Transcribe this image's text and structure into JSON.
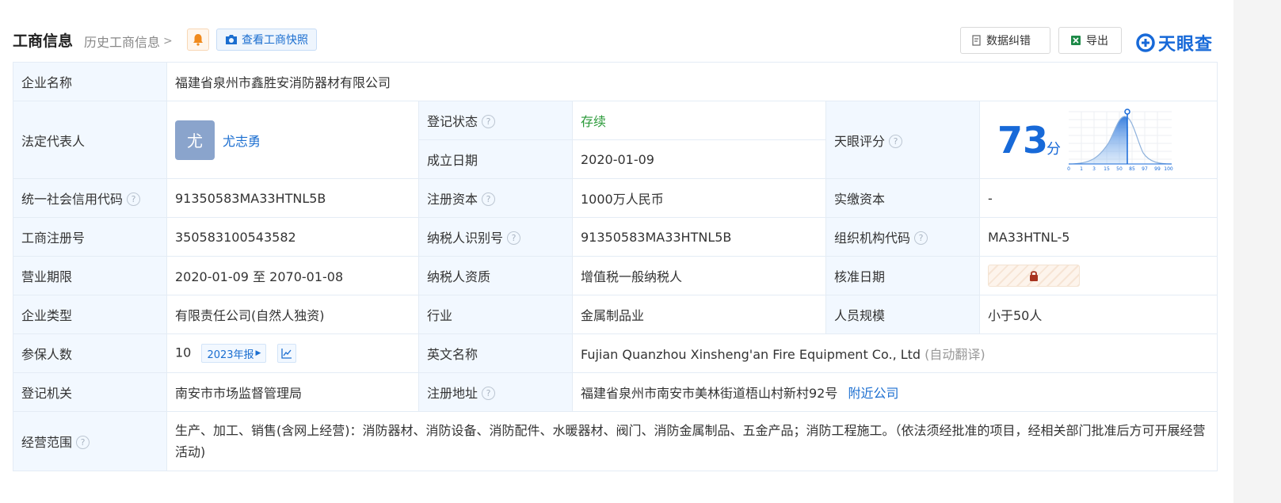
{
  "header": {
    "title": "工商信息",
    "history_link": "历史工商信息",
    "snapshot_label": "查看工商快照",
    "correct_label": "数据纠错",
    "export_label": "导出",
    "logo_text": "天眼查"
  },
  "colors": {
    "accent": "#1769d8",
    "label_bg": "#f2f8ff",
    "status_green": "#2b9a3a"
  },
  "company": {
    "name_label": "企业名称",
    "name": "福建省泉州市鑫胜安消防器材有限公司",
    "legal_label": "法定代表人",
    "legal_avatar": "尤",
    "legal_name": "尤志勇",
    "status_label": "登记状态",
    "status": "存续",
    "founded_label": "成立日期",
    "founded": "2020-01-09",
    "score_label": "天眼评分",
    "score": "73",
    "score_unit": "分",
    "score_ticks": [
      "0",
      "1",
      "3",
      "15",
      "50",
      "85",
      "97",
      "99",
      "100"
    ],
    "credit_label": "统一社会信用代码",
    "credit": "91350583MA33HTNL5B",
    "reg_capital_label": "注册资本",
    "reg_capital": "1000万人民币",
    "paid_capital_label": "实缴资本",
    "paid_capital": "-",
    "reg_no_label": "工商注册号",
    "reg_no": "350583100543582",
    "taxpayer_id_label": "纳税人识别号",
    "taxpayer_id": "91350583MA33HTNL5B",
    "org_code_label": "组织机构代码",
    "org_code": "MA33HTNL-5",
    "term_label": "营业期限",
    "term": "2020-01-09 至 2070-01-08",
    "taxpayer_qual_label": "纳税人资质",
    "taxpayer_qual": "增值税一般纳税人",
    "approve_label": "核准日期",
    "type_label": "企业类型",
    "type": "有限责任公司(自然人独资)",
    "industry_label": "行业",
    "industry": "金属制品业",
    "staff_label": "人员规模",
    "staff": "小于50人",
    "insured_label": "参保人数",
    "insured": "10",
    "insured_year": "2023年报",
    "english_label": "英文名称",
    "english": "Fujian Quanzhou Xinsheng'an Fire Equipment Co., Ltd",
    "english_note": "(自动翻译)",
    "authority_label": "登记机关",
    "authority": "南安市市场监督管理局",
    "address_label": "注册地址",
    "address": "福建省泉州市南安市美林街道梧山村新村92号",
    "nearby": "附近公司",
    "scope_label": "经营范围",
    "scope": "生产、加工、销售(含网上经营)：消防器材、消防设备、消防配件、水暖器材、阀门、消防金属制品、五金产品；消防工程施工。（依法须经批准的项目，经相关部门批准后方可开展经营活动)"
  }
}
